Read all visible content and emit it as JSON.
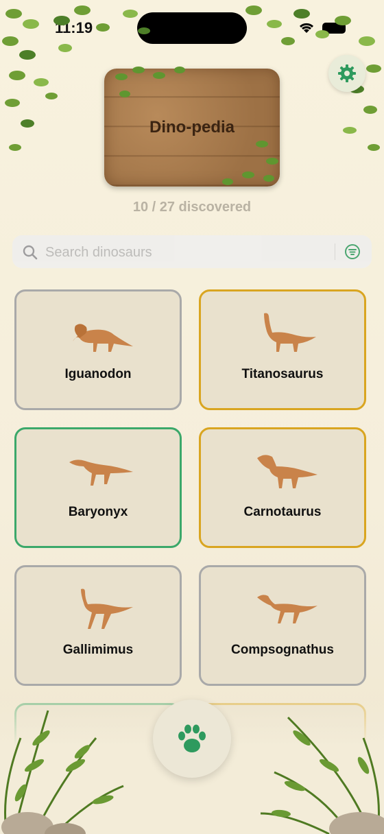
{
  "status_bar": {
    "time": "11:19"
  },
  "header": {
    "title": "Dino-pedia",
    "progress_text": "10 / 27 discovered"
  },
  "search": {
    "placeholder": "Search dinosaurs",
    "value": ""
  },
  "dinosaurs": [
    {
      "name": "Iguanodon",
      "border": "#a9a9a9"
    },
    {
      "name": "Titanosaurus",
      "border": "#d9a520"
    },
    {
      "name": "Baryonyx",
      "border": "#3ba86a"
    },
    {
      "name": "Carnotaurus",
      "border": "#d9a520"
    },
    {
      "name": "Gallimimus",
      "border": "#a9a9a9"
    },
    {
      "name": "Compsognathus",
      "border": "#a9a9a9"
    }
  ],
  "colors": {
    "accent": "#2e9a5e",
    "card_bg": "#e9e1cd"
  },
  "icons": {
    "settings": "gear-icon",
    "search": "search-icon",
    "filter": "filter-icon",
    "fab": "paw-icon"
  }
}
